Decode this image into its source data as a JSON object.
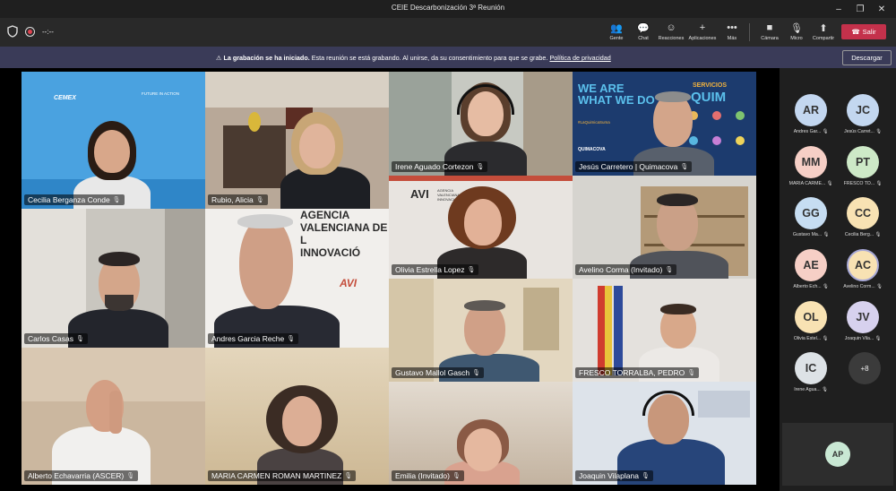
{
  "window": {
    "title": "CEIE Descarbonización 3ª Reunión",
    "minimize": "–",
    "restore": "❐",
    "close": "✕"
  },
  "toolbar": {
    "timer": "--:--",
    "buttons": [
      {
        "label": "Gente",
        "glyph": "👥"
      },
      {
        "label": "Chat",
        "glyph": "💬"
      },
      {
        "label": "Reacciones",
        "glyph": "☺"
      },
      {
        "label": "Aplicaciones",
        "glyph": "+"
      },
      {
        "label": "Más",
        "glyph": "•••"
      },
      {
        "label": "Cámara",
        "glyph": "■"
      },
      {
        "label": "Micro",
        "glyph": "🎙"
      },
      {
        "label": "Compartir",
        "glyph": "⬆"
      }
    ],
    "leave_label": "Salir",
    "leave_glyph": "☎"
  },
  "banner": {
    "icon": "⚠",
    "bold": "La grabación se ha iniciado.",
    "text": " Esta reunión se está grabando. Al unirse, da su consentimiento para que se grabe. ",
    "link": "Política de privacidad",
    "download_label": "Descargar"
  },
  "tiles": [
    {
      "name": "Cecilia Berganza Conde"
    },
    {
      "name": "Rubio, Alicia"
    },
    {
      "name": "Irene Aguado Cortezon"
    },
    {
      "name": "Jesús Carretero | Quimacova"
    },
    {
      "name": "Olivia Estrella Lopez"
    },
    {
      "name": "Avelino Corma (Invitado)"
    },
    {
      "name": "Carlos Casas"
    },
    {
      "name": "Andres Garcia Reche"
    },
    {
      "name": "Gustavo Mallol Gasch"
    },
    {
      "name": "FRESCO TORRALBA, PEDRO"
    },
    {
      "name": "Alberto Echavarria (ASCER)"
    },
    {
      "name": "MARIA CARMEN ROMAN MARTINEZ"
    },
    {
      "name": "Emilia (Invitado)"
    },
    {
      "name": "Joaquin Vilaplana"
    }
  ],
  "backdrops": {
    "cemex_logo": "CEMEX",
    "future_in_action": "FUTURE IN ACTION",
    "avi_sign_1": "AGENCIA",
    "avi_sign_2": "VALENCIANA DE L",
    "avi_sign_3": "INNOVACIÓ",
    "avi_sign_4": "AVI",
    "avi_small": "AVI",
    "avi_small_text": "AGENCIA VALENCIANA INNOVACIÓ",
    "quim_we_are": "WE ARE",
    "quim_what": "WHAT WE DO",
    "quim_servicios": "SERVICIOS",
    "quim_quim": "QUIM",
    "quim_brand": "QUIMACOVA",
    "quim_hashtag": "#LaQuimicaSuma"
  },
  "roster": [
    {
      "initials": "AR",
      "name": "Andres Gar...",
      "color": "#c3d7f0"
    },
    {
      "initials": "JC",
      "name": "Jesús Carret...",
      "color": "#c3d7f0"
    },
    {
      "initials": "MM",
      "name": "MARIA CARME...",
      "color": "#f6cfc6"
    },
    {
      "initials": "PT",
      "name": "FRESCO TO...",
      "color": "#cde9c7"
    },
    {
      "initials": "GG",
      "name": "Gustavo Ma...",
      "color": "#c6ddf2"
    },
    {
      "initials": "CC",
      "name": "Cecilia Berg...",
      "color": "#f8e2b3"
    },
    {
      "initials": "AE",
      "name": "Alberto Ech...",
      "color": "#f6cfc6"
    },
    {
      "initials": "AC",
      "name": "Avelino Corm...",
      "color": "#f8e2b3"
    },
    {
      "initials": "OL",
      "name": "Olivia Estel...",
      "color": "#f8e2b3"
    },
    {
      "initials": "JV",
      "name": "Joaquin Vila...",
      "color": "#d7d1ee"
    },
    {
      "initials": "IC",
      "name": "Irene Agua...",
      "color": "#dde2e6"
    }
  ],
  "roster_more": "+8",
  "self_view": {
    "initials": "AP"
  },
  "colors": {
    "leave": "#c4314b",
    "banner": "#3a3b58",
    "toolbar": "#292929"
  }
}
